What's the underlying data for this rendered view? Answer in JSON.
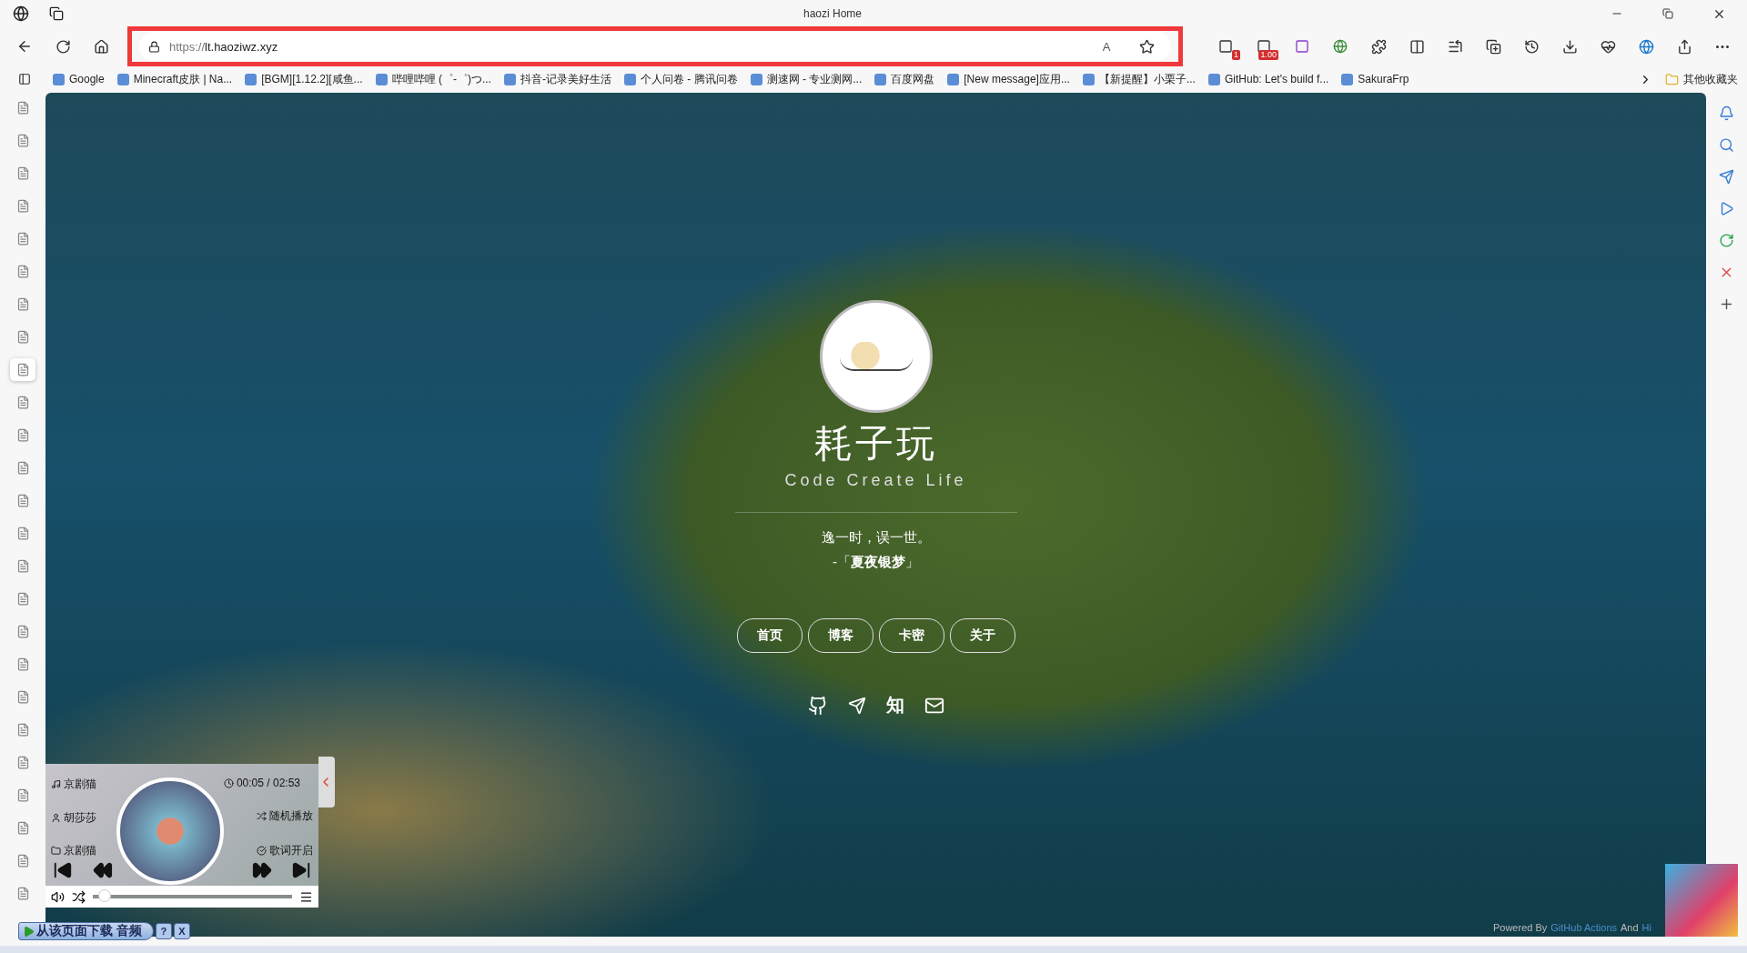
{
  "window": {
    "title": "haozi Home"
  },
  "toolbar": {
    "url_scheme": "https://",
    "url_host": "lt.haoziwz.xyz",
    "read_aloud": "A",
    "extension_badges": [
      {
        "text": "1"
      },
      {
        "text": "1.00"
      }
    ]
  },
  "bookmarks": [
    {
      "label": "Google"
    },
    {
      "label": "Minecraft皮肤 | Na..."
    },
    {
      "label": "[BGM][1.12.2][咸鱼..."
    },
    {
      "label": "哔哩哔哩 (゜-゜)つ..."
    },
    {
      "label": "抖音-记录美好生活"
    },
    {
      "label": "个人问卷 - 腾讯问卷"
    },
    {
      "label": "测速网 - 专业测网..."
    },
    {
      "label": "百度网盘"
    },
    {
      "label": "[New message]应用..."
    },
    {
      "label": "【新提醒】小栗子..."
    },
    {
      "label": "GitHub: Let's build f..."
    },
    {
      "label": "SakuraFrp"
    }
  ],
  "other_bookmarks": "其他收藏夹",
  "vertical_tabs": [
    {
      "selected": false
    },
    {
      "selected": false
    },
    {
      "selected": false
    },
    {
      "selected": false
    },
    {
      "selected": false
    },
    {
      "selected": false
    },
    {
      "selected": false
    },
    {
      "selected": false
    },
    {
      "selected": true
    },
    {
      "selected": false
    },
    {
      "selected": false
    },
    {
      "selected": false
    },
    {
      "selected": false
    },
    {
      "selected": false
    },
    {
      "selected": false
    },
    {
      "selected": false
    },
    {
      "selected": false
    },
    {
      "selected": false
    },
    {
      "selected": false
    },
    {
      "selected": false
    },
    {
      "selected": false
    },
    {
      "selected": false
    },
    {
      "selected": false
    },
    {
      "selected": false
    },
    {
      "selected": false
    }
  ],
  "page": {
    "site_title": "耗子玩",
    "subtitle": "Code Create Life",
    "quote": "逸一时，误一世。",
    "quote_author": "-「**夏夜银梦**」",
    "nav": [
      {
        "label": "首页"
      },
      {
        "label": "博客"
      },
      {
        "label": "卡密"
      },
      {
        "label": "关于"
      }
    ],
    "social_text_icon": "知",
    "footer": {
      "prefix": "Powered By",
      "link1": "GitHub Actions",
      "middle": "And",
      "link2": "Hi"
    }
  },
  "player": {
    "song": "京剧猫",
    "artist": "胡莎莎",
    "album": "京剧猫",
    "time": "00:05 / 02:53",
    "mode": "随机播放",
    "lyrics": "歌词开启",
    "level": 0.03
  },
  "download_bar": {
    "label": "从该页面下载 音频",
    "help": "?",
    "close": "X"
  }
}
